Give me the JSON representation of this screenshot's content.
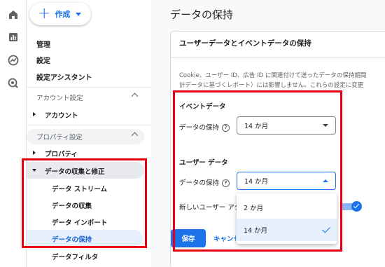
{
  "sidebar": {
    "create_label": "作成",
    "items_top": [
      "管理",
      "設定",
      "設定アシスタント"
    ],
    "account_section": "アカウント設定",
    "account_item": "アカウント",
    "property_section": "プロパティ設定",
    "property_item": "プロパティ",
    "data_group": "データの収集と修正",
    "sub_items": [
      "データ ストリーム",
      "データの収集",
      "データ インポート",
      "データの保持",
      "データフィルタ"
    ]
  },
  "main": {
    "page_title": "データの保持",
    "card_title": "ユーザーデータとイベントデータの保持",
    "desc_line1": "Cookie、ユーザー ID、広告 ID に関連付けて送ったデータの保持期間",
    "desc_line2": "計データに基づくレポート）には影響しません。これらの設定に変更",
    "event_section": "イベントデータ",
    "event_label": "データの保持",
    "event_value": "14 か月",
    "user_section": "ユーザー データ",
    "user_label": "データの保持",
    "user_value": "14 か月",
    "dropdown_options": [
      "2 か月",
      "14 か月"
    ],
    "toggle_label": "新しいユーザー アク",
    "save_label": "保存",
    "cancel_label": "キャンセル"
  },
  "colors": {
    "accent": "#1a73e8",
    "highlight": "#e60012",
    "selected_bg": "#e8f0fe"
  },
  "icons": [
    "home-icon",
    "reports-icon",
    "explore-icon",
    "advertising-icon",
    "help-circle-icon",
    "check-icon"
  ]
}
